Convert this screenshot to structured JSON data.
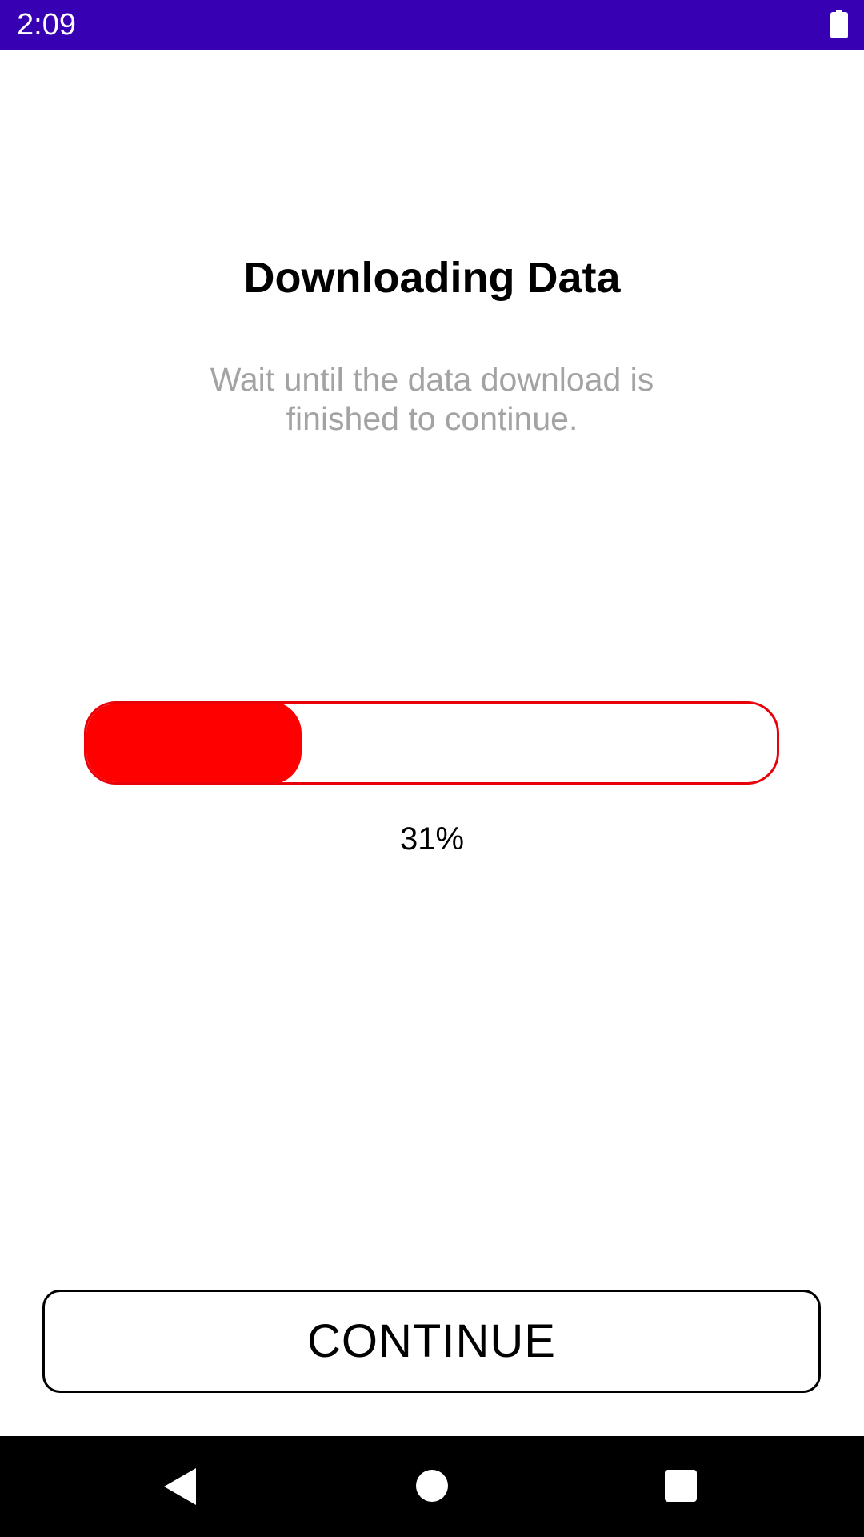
{
  "status_bar": {
    "time": "2:09",
    "background_color": "#3700b3",
    "battery_icon": "battery-full-icon"
  },
  "screen": {
    "title": "Downloading Data",
    "subtitle": "Wait until the data download is finished to continue."
  },
  "progress": {
    "value_percent": 31,
    "label": "31%",
    "fill_color": "#ff0000",
    "border_color": "#e8000b"
  },
  "actions": {
    "continue_label": "CONTINUE"
  },
  "nav_bar": {
    "back_icon": "back-triangle-icon",
    "home_icon": "home-circle-icon",
    "recents_icon": "recents-square-icon"
  }
}
